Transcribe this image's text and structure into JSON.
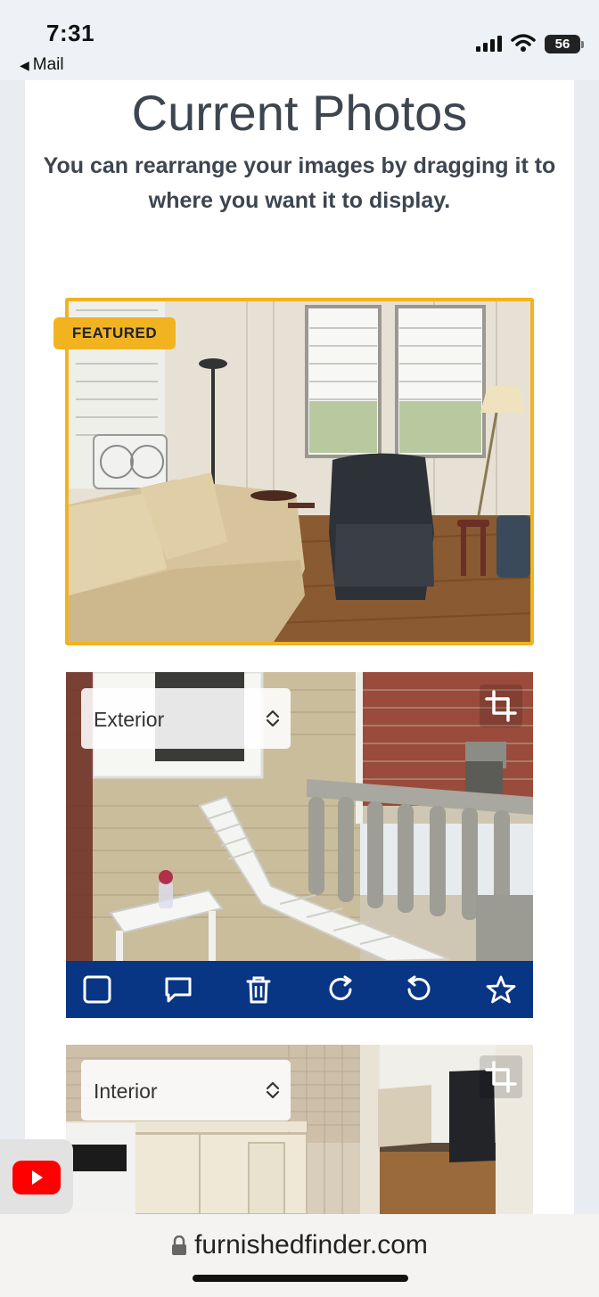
{
  "status_bar": {
    "time": "7:31",
    "back_app": "Mail",
    "battery": "56"
  },
  "header": {
    "title": "Current Photos",
    "subtitle": "You can rearrange your images by dragging it to where you want it to display."
  },
  "photos": [
    {
      "badge": "FEATURED"
    },
    {
      "category": "Exterior"
    },
    {
      "category": "Interior"
    }
  ],
  "toolbar": {
    "icons": [
      "checkbox-icon",
      "comment-icon",
      "trash-icon",
      "rotate-right-icon",
      "rotate-left-icon",
      "star-icon"
    ]
  },
  "browser": {
    "url": "furnishedfinder.com"
  },
  "colors": {
    "featured": "#f2b320",
    "toolbar": "#083584",
    "text": "#3d4650"
  }
}
